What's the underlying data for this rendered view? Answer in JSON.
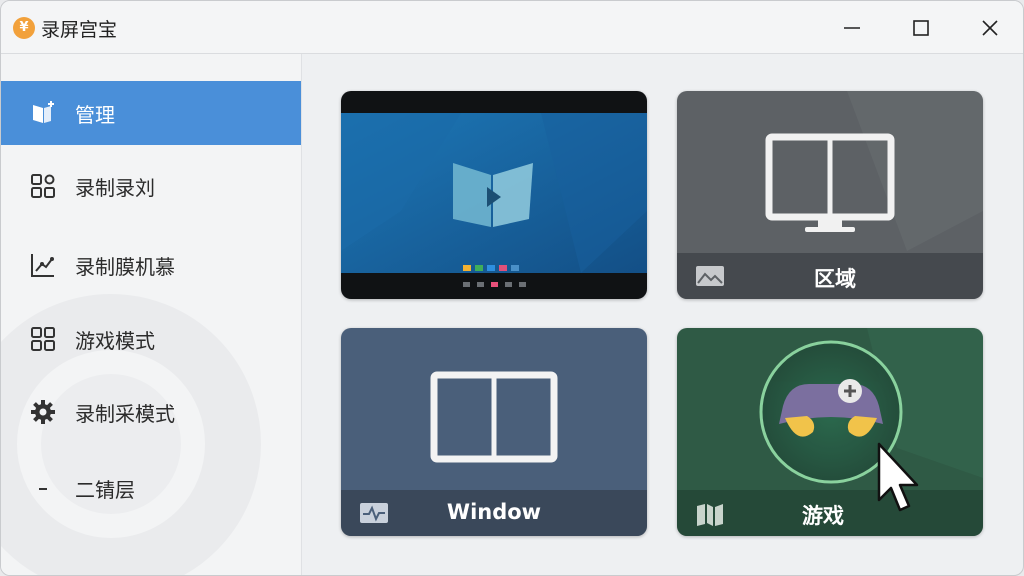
{
  "window": {
    "title": "录屏宫宝",
    "app_icon_glyph": "¥"
  },
  "sidebar": {
    "items": [
      {
        "label": "管理",
        "icon": "pin-board-icon",
        "active": true
      },
      {
        "label": "录制录刘",
        "icon": "grid-settings-icon"
      },
      {
        "label": "录制膜机慕",
        "icon": "chart-line-icon"
      },
      {
        "label": "游戏模式",
        "icon": "grid-icon"
      },
      {
        "label": "录制采模式",
        "icon": "gear-icon"
      },
      {
        "label": "二锖层",
        "icon": "chevron-down-icon"
      }
    ]
  },
  "cards": [
    {
      "label": "",
      "kind": "fullscreen-desktop-preview"
    },
    {
      "label": "区域",
      "kind": "region",
      "footer_icon": "image-icon"
    },
    {
      "label": "Window",
      "kind": "window",
      "footer_icon": "activity-icon"
    },
    {
      "label": "游戏",
      "kind": "game",
      "footer_icon": "map-icon"
    }
  ],
  "colors": {
    "accent": "#4a8fd9",
    "card_region": "#5d6165",
    "card_window": "#4a5f7a",
    "card_game": "#2f5a45"
  }
}
